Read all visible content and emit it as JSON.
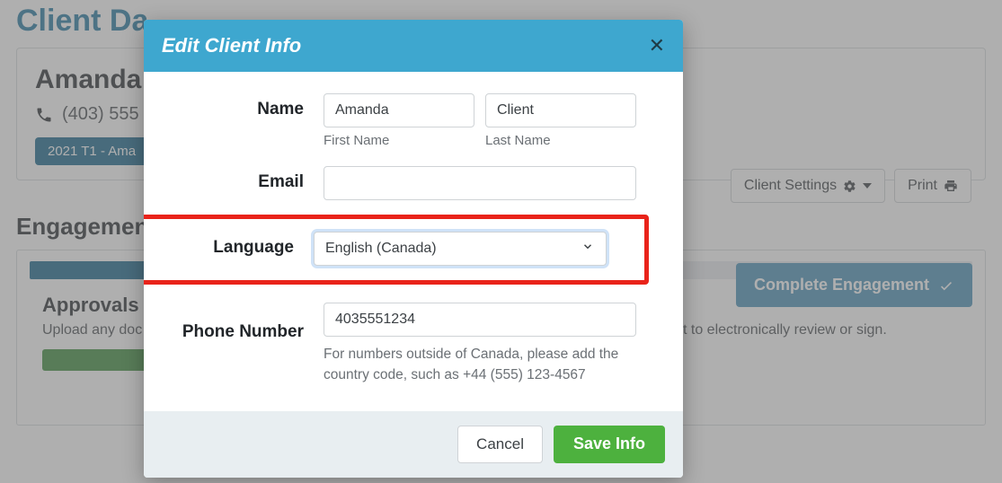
{
  "page": {
    "title": "Client Da",
    "client_name": "Amanda",
    "phone_display": "(403) 555",
    "pill": "2021 T1 - Ama",
    "client_settings_label": "Client Settings",
    "print_label": "Print",
    "engagement_heading": "Engagemen",
    "complete_engagement_label": "Complete Engagement",
    "approvals_heading": "Approvals",
    "approvals_desc_prefix": "Upload any doc",
    "approvals_desc_suffix": "client to electronically review or sign."
  },
  "modal": {
    "title": "Edit Client Info",
    "name_label": "Name",
    "first_name_value": "Amanda",
    "first_name_sublabel": "First Name",
    "last_name_value": "Client",
    "last_name_sublabel": "Last Name",
    "email_label": "Email",
    "email_value": "",
    "language_label": "Language",
    "language_value": "English (Canada)",
    "phone_label": "Phone Number",
    "phone_value": "4035551234",
    "phone_hint": "For numbers outside of Canada, please add the country code, such as +44 (555) 123-4567",
    "cancel_label": "Cancel",
    "save_label": "Save Info"
  }
}
